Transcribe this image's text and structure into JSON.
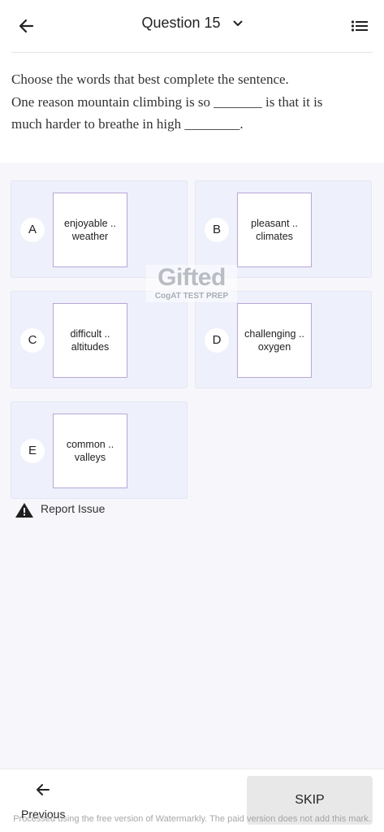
{
  "header": {
    "title": "Question 15",
    "icons": {
      "back": "arrow-left-icon",
      "dropdown": "chevron-down-icon",
      "list": "list-icon"
    }
  },
  "question": {
    "line1": "Choose the words that best complete the sentence.",
    "line2": "One reason mountain climbing is so _______ is that it is",
    "line3": "much harder to breathe in high ________."
  },
  "options": [
    {
      "letter": "A",
      "line1": "enjoyable ..",
      "line2": "weather"
    },
    {
      "letter": "B",
      "line1": "pleasant ..",
      "line2": "climates"
    },
    {
      "letter": "C",
      "line1": "difficult ..",
      "line2": "altitudes"
    },
    {
      "letter": "D",
      "line1": "challenging ..",
      "line2": "oxygen"
    },
    {
      "letter": "E",
      "line1": "common ..",
      "line2": "valleys"
    }
  ],
  "watermark": {
    "logo": "Gifted",
    "sub": "CogAT TEST PREP"
  },
  "report": {
    "label": "Report Issue",
    "icon": "warning-icon"
  },
  "bottom": {
    "previous_label": "Previous",
    "skip_label": "SKIP",
    "note": "Processed using the free version of Watermarkly. The paid version does not add this mark."
  },
  "colors": {
    "option_bg": "#eef0fb",
    "card_border": "#b9a6d6",
    "skip_bg": "#e8e8e8"
  }
}
